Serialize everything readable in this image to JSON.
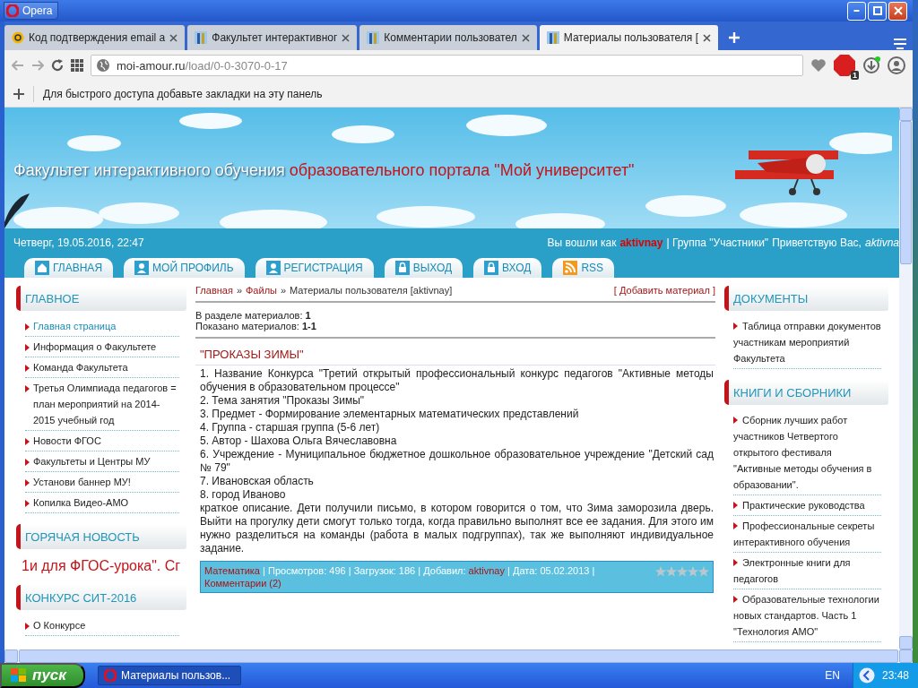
{
  "window": {
    "title": "Opera"
  },
  "browser": {
    "tabs": [
      {
        "title": "Код подтверждения email a",
        "kind": "mail",
        "selected": false
      },
      {
        "title": "Факультет интерактивног",
        "kind": "site",
        "selected": false
      },
      {
        "title": "Комментарии пользовател",
        "kind": "site",
        "selected": false
      },
      {
        "title": "Материалы пользователя [",
        "kind": "site",
        "selected": true
      }
    ],
    "address": {
      "host": "moi-amour.ru",
      "path": "/load/0-0-3070-0-17"
    },
    "adblock_count": "1",
    "bookmarks_hint": "Для быстрого доступа добавьте закладки на эту панель"
  },
  "site": {
    "title": "Факультет интерактивного обучения",
    "title_accent": "образовательного портала \"Мой университет\"",
    "datetime": "Четверг, 19.05.2016, 22:47",
    "login": {
      "prefix": "Вы вошли как",
      "user": "aktivnay",
      "group": "| Группа \"Участники\"",
      "greeting": "Приветствую Вас,",
      "greeting_user": "aktivna"
    },
    "nav": [
      {
        "label": "ГЛАВНАЯ",
        "kind": "home"
      },
      {
        "label": "МОЙ ПРОФИЛЬ",
        "kind": "user"
      },
      {
        "label": "РЕГИСТРАЦИЯ",
        "kind": "user"
      },
      {
        "label": "ВЫХОД",
        "kind": "lock"
      },
      {
        "label": "ВХОД",
        "kind": "lock"
      },
      {
        "label": "RSS",
        "kind": "rss"
      }
    ]
  },
  "left_blocks": [
    {
      "title": "ГЛАВНОЕ",
      "kind": "links",
      "items": [
        {
          "text": "Главная страница",
          "selected": true
        },
        {
          "text": "Информация о Факультете",
          "selected": false
        },
        {
          "text": "Команда Факультета",
          "selected": false
        },
        {
          "text": "Третья Олимпиада педагогов = план мероприятий на 2014-2015 учебный год",
          "selected": false
        },
        {
          "text": "Новости ФГОС",
          "selected": false
        },
        {
          "text": "Факультеты и Центры МУ",
          "selected": false
        },
        {
          "text": "Установи баннер МУ!",
          "selected": false
        },
        {
          "text": "Копилка Видео-АМО",
          "selected": false
        }
      ]
    },
    {
      "title": "ГОРЯЧАЯ НОВОСТЬ",
      "kind": "ticker",
      "text": "1и для ФГОС-урока\". Сг"
    },
    {
      "title": "КОНКУРС СИТ-2016",
      "kind": "links",
      "items": [
        {
          "text": "О Конкурсе",
          "selected": false
        }
      ]
    }
  ],
  "main": {
    "breadcrumbs": [
      {
        "text": "Главная",
        "link": true
      },
      {
        "text": "Файлы",
        "link": true
      },
      {
        "text": "Материалы пользователя [aktivnay]",
        "link": false
      }
    ],
    "separator": "»",
    "add_link": "[ Добавить материал ]",
    "meta_separator": "|",
    "counts": [
      "В разделе материалов: **1**",
      "Показано материалов: **1-1**"
    ],
    "entry": {
      "title": "\"ПРОКАЗЫ ЗИМЫ\"",
      "lines": [
        "1. Название Конкурса \"Третий открытый профессиональный конкурс педагогов \"Активные методы обучения в образовательном процессе\"",
        "2. Тема занятия \"Проказы Зимы\"",
        "3. Предмет - Формирование элементарных математических представлений",
        "4. Группа - старшая группа (5-6 лет)",
        "5. Автор - Шахова Ольга Вячеславовна",
        "6. Учреждение - Муниципальное бюджетное дошкольное образовательное учреждение \"Детский сад № 79\"",
        "7. Ивановская область",
        "8. город Иваново",
        "краткое описание. Дети получили письмо, в котором говорится о том, что Зима заморозила дверь. Выйти на прогулку дети смогут только тогда, когда правильно выполнят все ее задания. Для этого им нужно разделиться на команды (работа в малых подгруппах), так же выполняют индивидуальное задание."
      ],
      "category": "Математика",
      "views": "Просмотров: 496",
      "downloads": "Загрузок: 186",
      "added_label": "Добавил:",
      "author": "aktivnay",
      "date": "Дата: 05.02.2013",
      "comments": "Комментарии (2)",
      "stars": 0
    }
  },
  "right_blocks": [
    {
      "title": "ДОКУМЕНТЫ",
      "items": [
        "Таблица отправки документов участникам мероприятий Факультета"
      ]
    },
    {
      "title": "КНИГИ И СБОРНИКИ",
      "items": [
        "Сборник лучших работ участников Четвертого открытого фестиваля \"Активные методы обучения в образовании\".",
        "Практические руководства",
        "Профессиональные секреты интерактивного обучения",
        "Электронные книги для педагогов",
        "Образовательные технологии новых стандартов. Часть 1 \"Технология АМО\""
      ]
    }
  ],
  "taskbar": {
    "start": "пуск",
    "task": "Материалы пользов...",
    "language": "EN",
    "clock": "23:48"
  }
}
